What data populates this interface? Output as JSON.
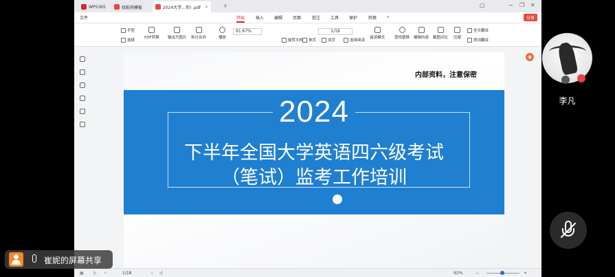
{
  "tabs": [
    {
      "label": "WPS365"
    },
    {
      "label": "找稻壳模板"
    },
    {
      "label": "2024大学...你) .pdf"
    }
  ],
  "menu": {
    "file": "文件",
    "items": [
      "开始",
      "插入",
      "编辑",
      "页面",
      "批注",
      "工具",
      "保护",
      "转换"
    ],
    "active": "开始",
    "share": "分享"
  },
  "ribbon": {
    "hand": "手型",
    "select": "选择",
    "pdf_convert": "PDF转换",
    "export_image": "输出为图片",
    "split_merge": "拆分合并",
    "play": "播放",
    "zoom": "91.67%",
    "page": "1/18",
    "rotate": "旋转文档",
    "single": "单页",
    "double": "双页",
    "continuous": "连续阅读",
    "read_mode": "阅读模式",
    "find_replace": "查找替换",
    "edit_content": "编辑内容",
    "screenshot_compare": "截图对比",
    "compress": "压缩",
    "full_translate": "全文翻译",
    "short_translate": "划词翻译"
  },
  "slide": {
    "confidential": "内部资料，注意保密",
    "year": "2024",
    "title_line1": "下半年全国大学英语四六级考试",
    "title_line2": "（笔试）监考工作培训"
  },
  "statusbar": {
    "page": "1/18",
    "zoom": "92%"
  },
  "participant": {
    "name": "李凡"
  },
  "screen_share": {
    "label": "崔妮的屏幕共享"
  },
  "colors": {
    "band": "#1f7fd1",
    "accent": "#d9262c",
    "share_badge": "#f08a24"
  }
}
